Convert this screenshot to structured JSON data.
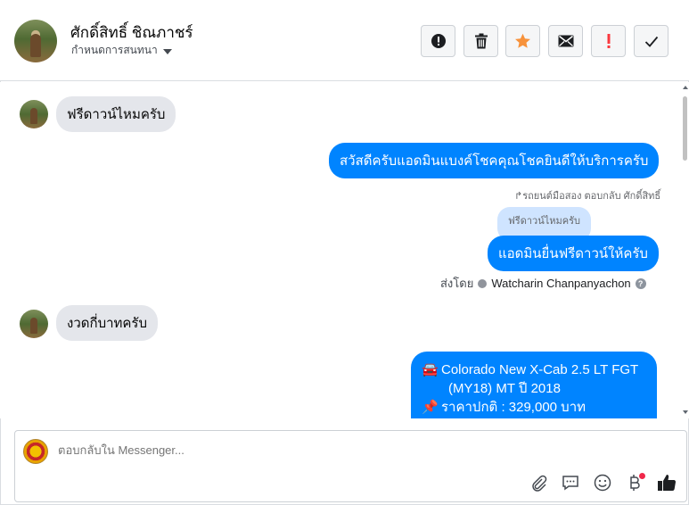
{
  "header": {
    "contact_name": "ศักดิ์สิทธิ์ ชิณภาชร์",
    "assign_label": "กำหนดการสนทนา",
    "tools": [
      {
        "icon": "alert-circle-icon",
        "name": "report"
      },
      {
        "icon": "trash-icon",
        "name": "delete"
      },
      {
        "icon": "star-icon",
        "name": "star",
        "color": "#f7923b"
      },
      {
        "icon": "envelope-icon",
        "name": "mark-unread"
      },
      {
        "icon": "exclamation-icon",
        "name": "spam",
        "color": "#fa383e"
      },
      {
        "icon": "check-icon",
        "name": "done"
      }
    ]
  },
  "messages": [
    {
      "from": "customer",
      "text": "ฟรีดาวน์ไหมครับ"
    },
    {
      "from": "page",
      "text": "สวัสดีครับแอดมินแบงค์โชคคุณโชคยินดีให้บริการครับ"
    },
    {
      "from": "page-reply",
      "reply_meta": "↱รถยนต์มือสอง ตอบกลับ ศักดิ์สิทธิ์",
      "quoted": "ฟรีดาวน์ไหมครับ",
      "text": "แอดมินยื่นฟรีดาวน์ให้ครับ"
    },
    {
      "from": "customer",
      "text": "งวดกี่บาทครับ"
    }
  ],
  "sent_by": {
    "label": "ส่งโดย",
    "agent": "Watcharin Chanpanyachon"
  },
  "car_message": {
    "line1_emoji": "🚘",
    "line1": "Colorado New X-Cab 2.5 LT FGT",
    "line2": "(MY18) MT ปี 2018",
    "line3_emoji": "📌",
    "line3": "ราคาปกติ : 329,000 บาท"
  },
  "composer": {
    "placeholder": "ตอบกลับใน Messenger...",
    "icons": [
      "paperclip-icon",
      "saved-reply-icon",
      "emoji-icon",
      "baht-icon",
      "thumbs-up-icon"
    ]
  },
  "colors": {
    "accent": "#0084ff",
    "incoming": "#e4e6eb",
    "quoted": "#cfe4ff"
  }
}
